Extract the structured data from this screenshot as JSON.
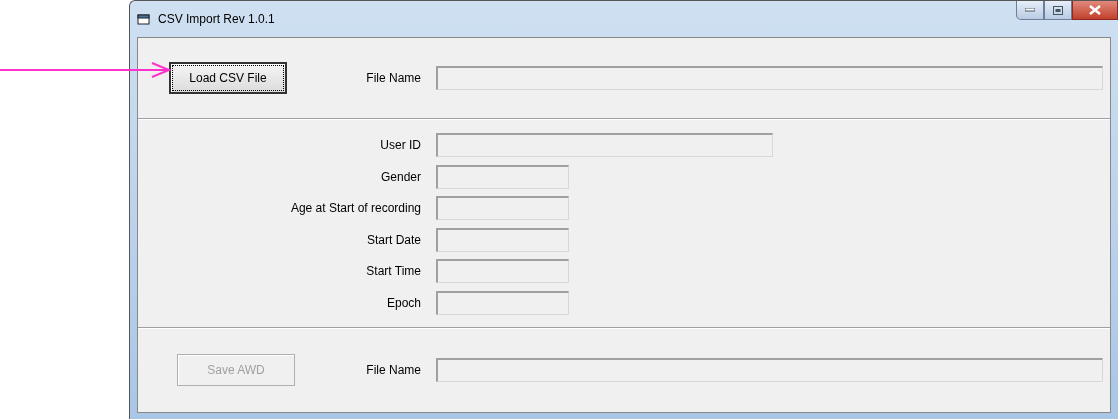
{
  "window": {
    "title": "CSV Import Rev 1.0.1"
  },
  "load_section": {
    "button": {
      "label": "Load CSV File",
      "focused": true,
      "disabled": false
    },
    "field": {
      "label": "File Name"
    }
  },
  "fields": [
    {
      "label": "User ID",
      "kind": "wide"
    },
    {
      "label": "Gender",
      "kind": "short"
    },
    {
      "label": "Age at Start of recording",
      "kind": "short"
    },
    {
      "label": "Start Date",
      "kind": "short"
    },
    {
      "label": "Start Time",
      "kind": "short"
    },
    {
      "label": "Epoch",
      "kind": "short"
    }
  ],
  "save_section": {
    "button": {
      "label": "Save AWD",
      "focused": false,
      "disabled": true
    },
    "field": {
      "label": "File Name"
    }
  }
}
